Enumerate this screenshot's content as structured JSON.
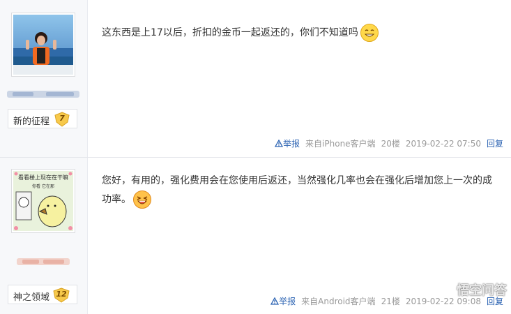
{
  "posts": [
    {
      "username": "",
      "rank_name": "新的征程",
      "level": "7",
      "content": "这东西是上17以后，折扣的金币一起返还的，你们不知道吗",
      "report_label": "举报",
      "client": "来自iPhone客户端",
      "floor": "20楼",
      "timestamp": "2019-02-22 07:50",
      "reply_label": "回复"
    },
    {
      "username": "",
      "rank_name": "神之领域",
      "level": "12",
      "avatar_caption": "看看楼上现在在干嘛",
      "avatar_subcaption": "你看 它在那",
      "content": "您好，有用的，强化费用会在您使用后返还，当然强化几率也会在强化后增加您上一次的成功率。",
      "report_label": "举报",
      "client": "来自Android客户端",
      "floor": "21楼",
      "timestamp": "2019-02-22 09:08",
      "reply_label": "回复"
    }
  ],
  "watermark": {
    "text": "悟空问答",
    "icon": "wukong-logo-icon"
  },
  "icons": {
    "report": "warning-triangle-icon",
    "emoji1": "grin-emoji-icon",
    "emoji2": "laugh-emoji-icon"
  },
  "colors": {
    "link": "#2d64b3",
    "meta": "#999999",
    "sidebar": "#f7f8fa"
  }
}
